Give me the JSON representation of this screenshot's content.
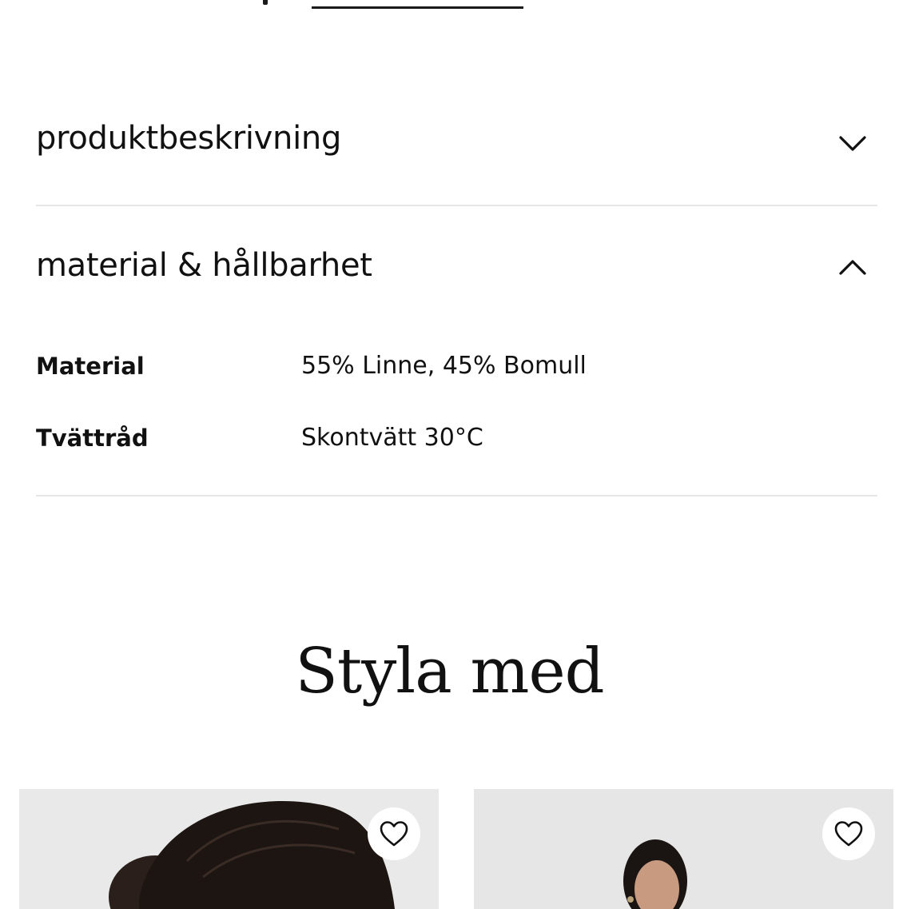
{
  "accordion": {
    "items": [
      {
        "title": "produktbeskrivning",
        "expanded": false,
        "icon": "chevron-down-icon"
      },
      {
        "title": "material & hållbarhet",
        "expanded": true,
        "icon": "chevron-up-icon"
      }
    ]
  },
  "specs": {
    "material_label": "Material",
    "material_value": "55% Linne, 45% Bomull",
    "care_label": "Tvättråd",
    "care_value": "Skontvätt 30°C"
  },
  "styla_med": {
    "heading": "Styla med",
    "products": [
      {
        "image": "product-photo",
        "favorite_icon": "heart-icon"
      },
      {
        "image": "product-photo",
        "favorite_icon": "heart-icon"
      }
    ]
  },
  "colors": {
    "text": "#111111",
    "divider": "#e6e6e6",
    "card_bg": "#e9e9e9"
  }
}
